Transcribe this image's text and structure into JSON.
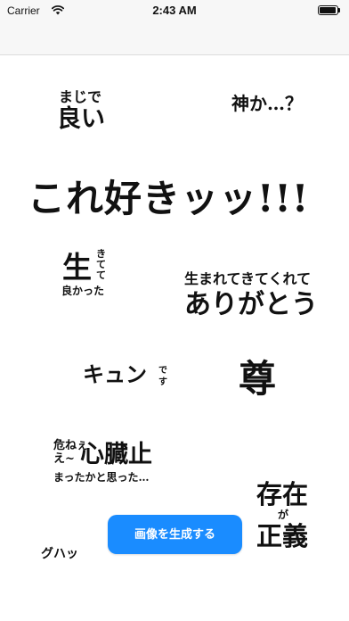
{
  "status_bar": {
    "carrier": "Carrier",
    "time": "2:43 AM"
  },
  "phrases": {
    "maji_top": "まじで",
    "maji_bottom": "良い",
    "kami": "神か…？",
    "korezuki": "これ好きッッ!!!",
    "sei_big": "生",
    "sei_kite_1": "き",
    "sei_kite_2": "て",
    "sei_kite_3": "て",
    "sei_bottom": "良かった",
    "umarete_top": "生まれてきてくれて",
    "umarete_bottom": "ありがとう",
    "kyun": "キュン",
    "kyun_desu_1": "で",
    "kyun_desu_2": "す",
    "toutoi": "尊",
    "abunee_1": "危ねぇ",
    "abunee_2": "え~",
    "shinzou": "心臓止",
    "mattaka": "まったかと思った…",
    "sonzai": "存在",
    "ga": "が",
    "seigi": "正義",
    "guhah": "グハッ"
  },
  "generate_button": {
    "label": "画像を生成する",
    "color": "#1a8cff"
  }
}
